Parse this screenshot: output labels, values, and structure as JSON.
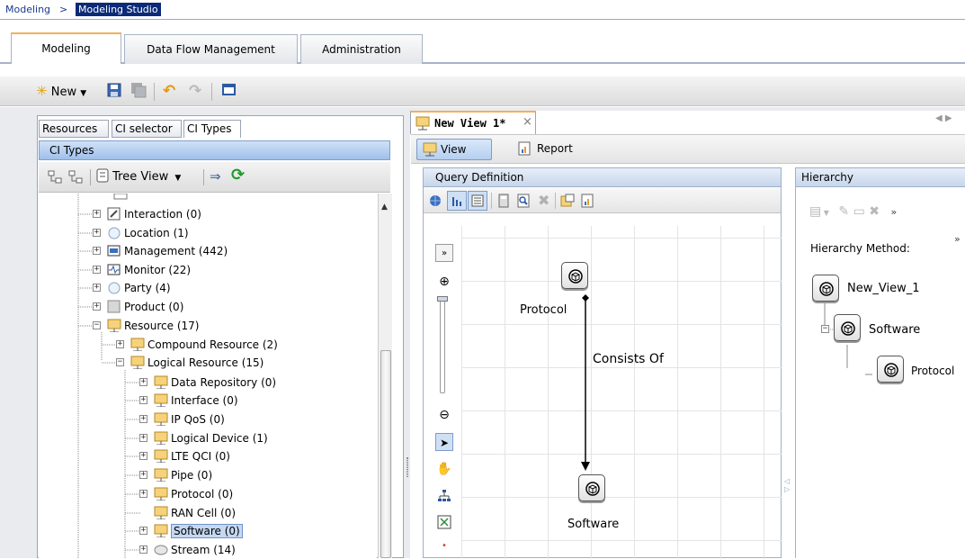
{
  "breadcrumb": {
    "home": "Modeling",
    "separator": ">",
    "current": "Modeling Studio"
  },
  "main_tabs": [
    {
      "label": "Modeling",
      "active": true
    },
    {
      "label": "Data Flow Management",
      "active": false
    },
    {
      "label": "Administration",
      "active": false
    }
  ],
  "toolbar": {
    "new_label": "New"
  },
  "left_panel": {
    "subtabs": [
      {
        "label": "Resources",
        "active": false
      },
      {
        "label": "CI selector",
        "active": false
      },
      {
        "label": "CI Types",
        "active": true
      }
    ],
    "header": "CI Types",
    "tree_view_label": "Tree View",
    "tree": [
      {
        "label": "Interaction (0)"
      },
      {
        "label": "Location (1)"
      },
      {
        "label": "Management (442)"
      },
      {
        "label": "Monitor (22)"
      },
      {
        "label": "Party (4)"
      },
      {
        "label": "Product (0)"
      },
      {
        "label": "Resource (17)"
      },
      {
        "label": "Compound Resource (2)"
      },
      {
        "label": "Logical Resource (15)"
      },
      {
        "label": "Data Repository (0)"
      },
      {
        "label": "Interface (0)"
      },
      {
        "label": "IP QoS (0)"
      },
      {
        "label": "Logical Device (1)"
      },
      {
        "label": "LTE QCI (0)"
      },
      {
        "label": "Pipe (0)"
      },
      {
        "label": "Protocol (0)"
      },
      {
        "label": "RAN Cell (0)"
      },
      {
        "label": "Software (0)",
        "selected": true
      },
      {
        "label": "Stream (14)"
      }
    ]
  },
  "view_tab": {
    "label": "New View 1*"
  },
  "view_toolbar": {
    "view_label": "View",
    "report_label": "Report"
  },
  "query_definition": {
    "header": "Query Definition",
    "nodes": {
      "protocol": "Protocol",
      "software": "Software"
    },
    "relationship": "Consists Of"
  },
  "hierarchy": {
    "header": "Hierarchy",
    "method_label": "Hierarchy Method:",
    "nodes": {
      "root": "New_View_1",
      "software": "Software",
      "protocol": "Protocol"
    }
  }
}
